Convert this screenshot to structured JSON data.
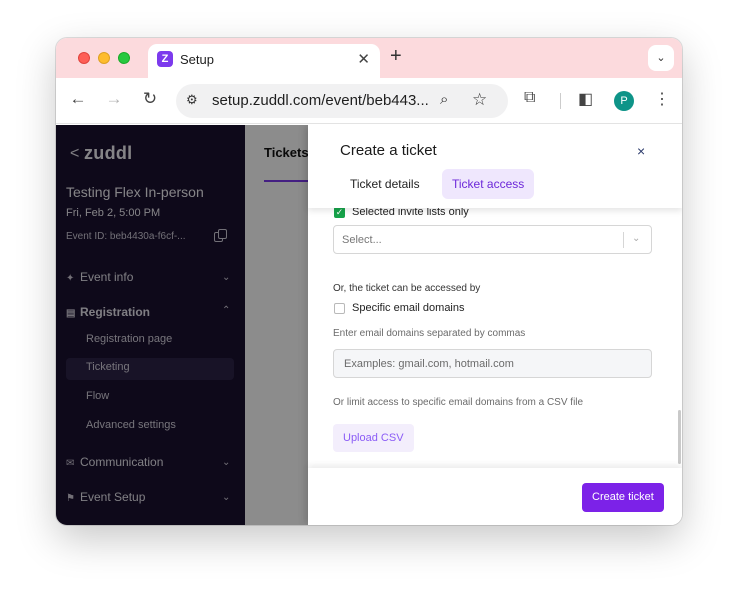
{
  "browser": {
    "tab_title": "Setup",
    "tab_favicon": "Z",
    "new_tab": "+",
    "url": "setup.zuddl.com/event/beb443...",
    "profile_initial": "P"
  },
  "sidebar": {
    "back": "<",
    "logo": "zuddl",
    "event_name": "Testing Flex In-person",
    "event_date": "Fri, Feb 2, 5:00 PM",
    "event_id": "Event ID: beb4430a-f6cf-...",
    "nav": {
      "event_info": "Event info",
      "registration": "Registration",
      "registration_page": "Registration page",
      "ticketing": "Ticketing",
      "flow": "Flow",
      "advanced_settings": "Advanced settings",
      "communication": "Communication",
      "event_setup": "Event Setup"
    }
  },
  "main": {
    "tab": "Tickets"
  },
  "drawer": {
    "title": "Create a ticket",
    "close": "×",
    "tabs": {
      "details": "Ticket details",
      "access": "Ticket access"
    },
    "invite_lists_label": "Selected invite lists only",
    "select_placeholder": "Select...",
    "or_label": "Or, the ticket can be accessed by",
    "email_domains_label": "Specific email domains",
    "domains_hint": "Enter email domains separated by commas",
    "domains_placeholder": "Examples: gmail.com, hotmail.com",
    "csv_hint": "Or limit access to specific email domains from a CSV file",
    "upload_csv": "Upload CSV",
    "create_button": "Create ticket"
  },
  "colors": {
    "accent": "#7c22e8",
    "sidebar_bg": "#1b1231",
    "tab_strip": "#fcdadd",
    "checkbox_on": "#16a34a"
  }
}
